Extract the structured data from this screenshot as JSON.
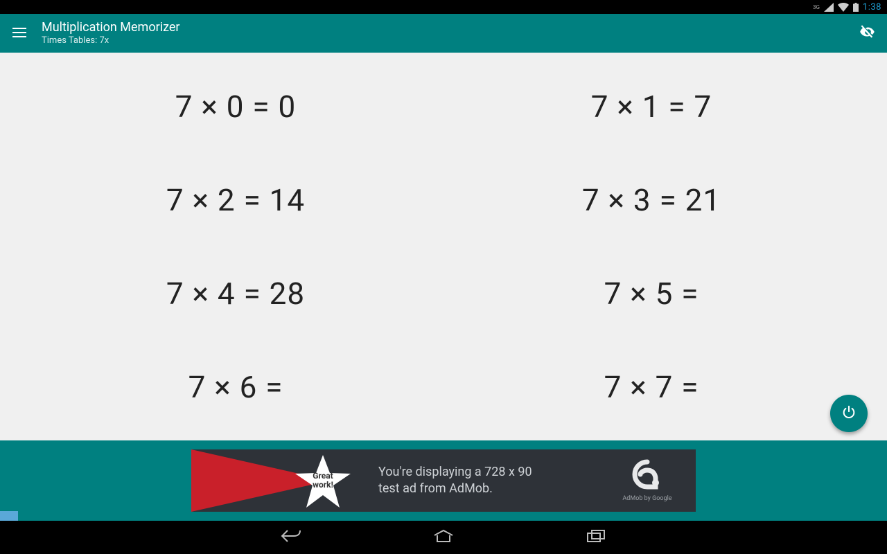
{
  "status_bar": {
    "network_label": "3G",
    "clock": "1:38"
  },
  "action_bar": {
    "title": "Multiplication Memorizer",
    "subtitle": "Times Tables: 7x"
  },
  "equations": [
    "7 × 0 = 0",
    "7 × 1 = 7",
    "7 × 2 = 14",
    "7 × 3 = 21",
    "7 × 4 = 28",
    "7 × 5 =",
    "7 × 6 =",
    "7 × 7 ="
  ],
  "ad": {
    "badge_line1": "Great",
    "badge_line2": "work!",
    "line1": "You're displaying a 728 x 90",
    "line2": "test ad from AdMob.",
    "logo_sub": "AdMob by Google"
  }
}
